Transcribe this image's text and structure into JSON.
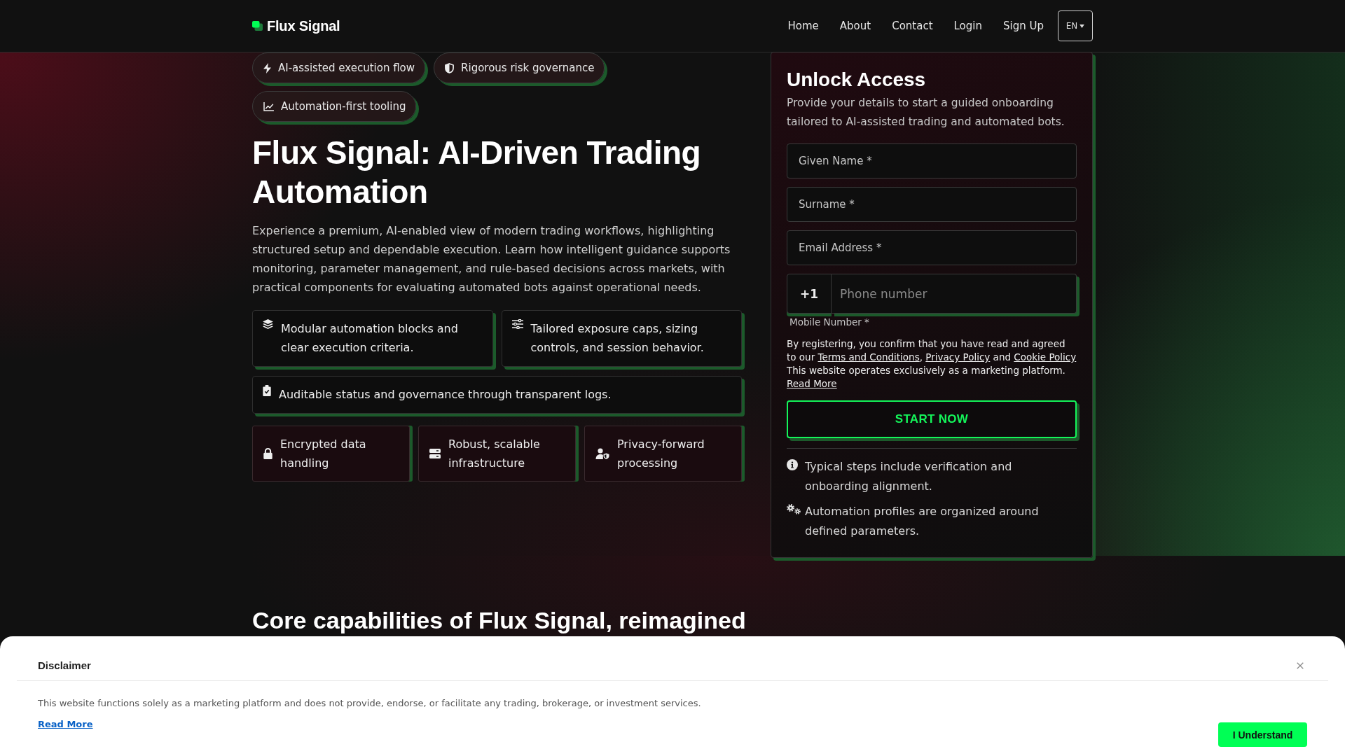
{
  "header": {
    "brand": "Flux Signal",
    "nav": [
      "Home",
      "About",
      "Contact",
      "Login",
      "Sign Up"
    ],
    "language": "EN"
  },
  "hero": {
    "badges": [
      "AI-assisted execution flow",
      "Rigorous risk governance",
      "Automation-first tooling"
    ],
    "title": "Flux Signal: AI-Driven Trading Automation",
    "description": "Experience a premium, AI-enabled view of modern trading workflows, highlighting structured setup and dependable execution. Learn how intelligent guidance supports monitoring, parameter management, and rule-based decisions across markets, with practical components for evaluating automated bots against operational needs.",
    "features": [
      "Modular automation blocks and clear execution criteria.",
      "Tailored exposure caps, sizing controls, and session behavior.",
      "Auditable status and governance through transparent logs."
    ],
    "assurances": [
      "Encrypted data handling",
      "Robust, scalable infrastructure",
      "Privacy-forward processing"
    ]
  },
  "signup": {
    "title": "Unlock Access",
    "subtitle": "Provide your details to start a guided onboarding tailored to AI-assisted trading and automated bots.",
    "fields": [
      {
        "placeholder": "Given Name *"
      },
      {
        "placeholder": "Surname *"
      },
      {
        "placeholder": "Email Address *"
      }
    ],
    "phone": {
      "country_code": "+1",
      "placeholder": "Phone number",
      "label": "Mobile Number *"
    },
    "consent": [
      {
        "kind": "text",
        "text": "By registering, you confirm that you have read and agreed to our "
      },
      {
        "kind": "link",
        "text": "Terms and Conditions"
      },
      {
        "kind": "text",
        "text": ", "
      },
      {
        "kind": "link",
        "text": "Privacy Policy"
      },
      {
        "kind": "text",
        "text": " and "
      },
      {
        "kind": "link",
        "text": "Cookie Policy"
      },
      {
        "kind": "text",
        "text": " This website operates exclusively as a marketing platform. "
      },
      {
        "kind": "link",
        "text": "Read More"
      }
    ],
    "submit": "START NOW",
    "notes": [
      "Typical steps include verification and onboarding alignment.",
      "Automation profiles are organized around defined parameters."
    ]
  },
  "capabilities": {
    "title": "Core capabilities of Flux Signal, reimagined"
  },
  "disclaimer": {
    "title": "Disclaimer",
    "text": "This website functions solely as a marketing platform and does not provide, endorse, or facilitate any trading, brokerage, or investment services.",
    "link": "Read More",
    "button": "I Understand"
  }
}
